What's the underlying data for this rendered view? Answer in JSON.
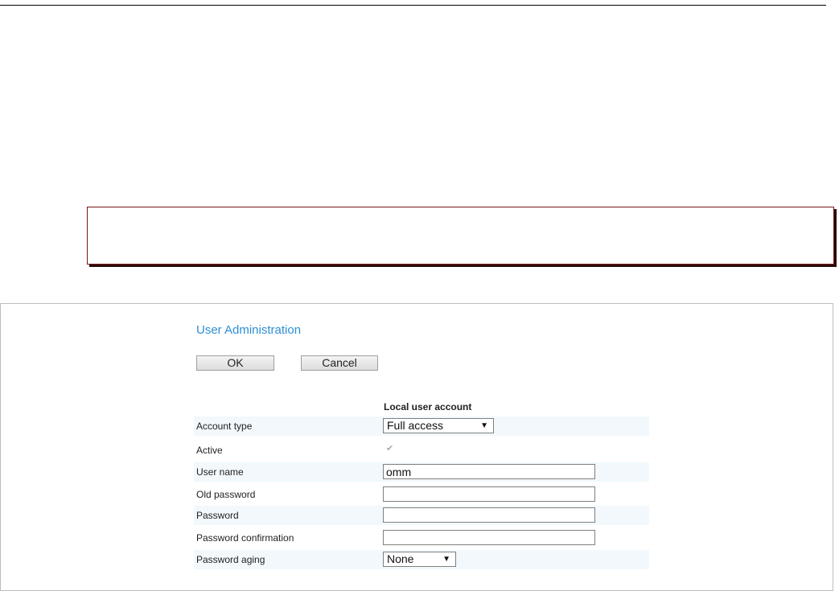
{
  "user_admin": {
    "title": "User Administration",
    "ok_label": "OK",
    "cancel_label": "Cancel",
    "section_heading": "Local user account",
    "fields": {
      "account_type": {
        "label": "Account type",
        "value": "Full access"
      },
      "active": {
        "label": "Active",
        "checked": true
      },
      "user_name": {
        "label": "User name",
        "value": "omm"
      },
      "old_password": {
        "label": "Old password",
        "value": ""
      },
      "password": {
        "label": "Password",
        "value": ""
      },
      "password_confirmation": {
        "label": "Password confirmation",
        "value": ""
      },
      "password_aging": {
        "label": "Password aging",
        "value": "None"
      }
    }
  },
  "colors": {
    "title_blue": "#2d8fd5",
    "note_border": "#7a1616",
    "row_shade": "#f2f8fc"
  },
  "icons": {
    "dropdown_arrow": "triangle-down",
    "active_check": "checkmark"
  }
}
